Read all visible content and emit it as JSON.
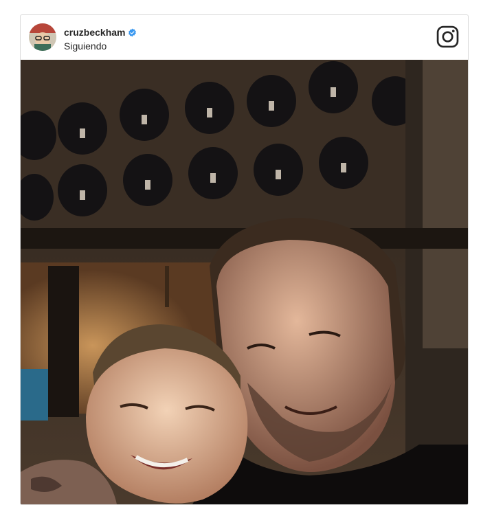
{
  "post": {
    "username": "cruzbeckham",
    "follow_status": "Siguiendo",
    "verified": true,
    "icons": {
      "verified": "verified-badge-icon",
      "brand": "instagram-logo-icon"
    },
    "colors": {
      "verified_blue": "#3897f0",
      "border": "#dbdbdb",
      "text": "#262626"
    }
  }
}
